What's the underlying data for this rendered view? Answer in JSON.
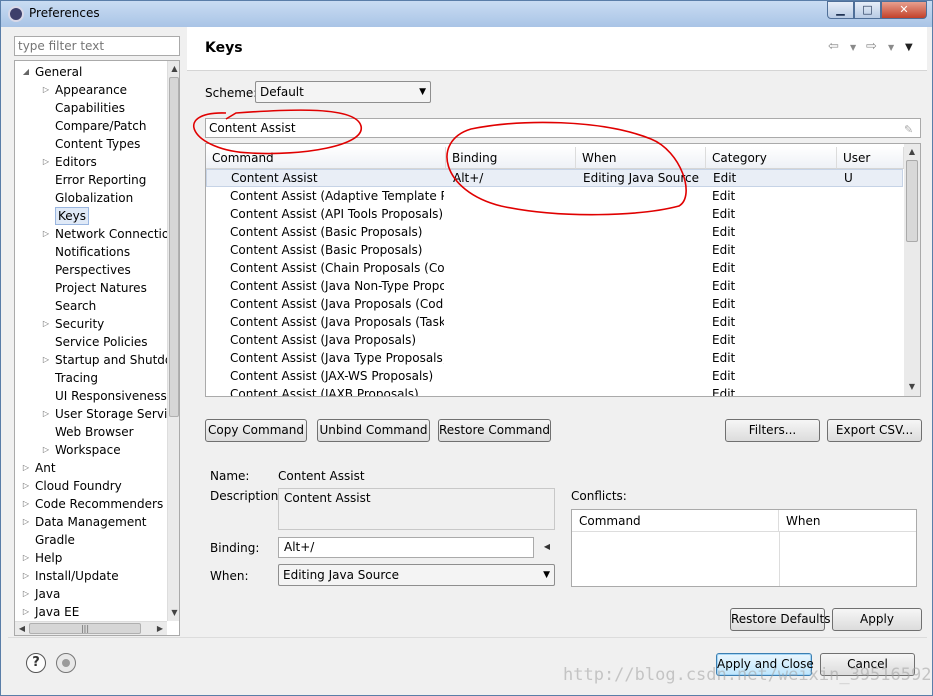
{
  "window": {
    "title": "Preferences",
    "min": "▁",
    "max": "□",
    "close": "✕"
  },
  "filter": {
    "placeholder": "type filter text"
  },
  "tree": [
    {
      "label": "General",
      "level": 0,
      "twisty": "expanded"
    },
    {
      "label": "Appearance",
      "level": 1,
      "twisty": "collapsed"
    },
    {
      "label": "Capabilities",
      "level": 1,
      "twisty": "none"
    },
    {
      "label": "Compare/Patch",
      "level": 1,
      "twisty": "none"
    },
    {
      "label": "Content Types",
      "level": 1,
      "twisty": "none"
    },
    {
      "label": "Editors",
      "level": 1,
      "twisty": "collapsed"
    },
    {
      "label": "Error Reporting",
      "level": 1,
      "twisty": "none"
    },
    {
      "label": "Globalization",
      "level": 1,
      "twisty": "none"
    },
    {
      "label": "Keys",
      "level": 1,
      "twisty": "none",
      "selected": true
    },
    {
      "label": "Network Connection",
      "level": 1,
      "twisty": "collapsed"
    },
    {
      "label": "Notifications",
      "level": 1,
      "twisty": "none"
    },
    {
      "label": "Perspectives",
      "level": 1,
      "twisty": "none"
    },
    {
      "label": "Project Natures",
      "level": 1,
      "twisty": "none"
    },
    {
      "label": "Search",
      "level": 1,
      "twisty": "none"
    },
    {
      "label": "Security",
      "level": 1,
      "twisty": "collapsed"
    },
    {
      "label": "Service Policies",
      "level": 1,
      "twisty": "none"
    },
    {
      "label": "Startup and Shutdov",
      "level": 1,
      "twisty": "collapsed"
    },
    {
      "label": "Tracing",
      "level": 1,
      "twisty": "none"
    },
    {
      "label": "UI Responsiveness M",
      "level": 1,
      "twisty": "none"
    },
    {
      "label": "User Storage Service",
      "level": 1,
      "twisty": "collapsed"
    },
    {
      "label": "Web Browser",
      "level": 1,
      "twisty": "none"
    },
    {
      "label": "Workspace",
      "level": 1,
      "twisty": "collapsed"
    },
    {
      "label": "Ant",
      "level": 0,
      "twisty": "collapsed"
    },
    {
      "label": "Cloud Foundry",
      "level": 0,
      "twisty": "collapsed"
    },
    {
      "label": "Code Recommenders",
      "level": 0,
      "twisty": "collapsed"
    },
    {
      "label": "Data Management",
      "level": 0,
      "twisty": "collapsed"
    },
    {
      "label": "Gradle",
      "level": 0,
      "twisty": "none"
    },
    {
      "label": "Help",
      "level": 0,
      "twisty": "collapsed"
    },
    {
      "label": "Install/Update",
      "level": 0,
      "twisty": "collapsed"
    },
    {
      "label": "Java",
      "level": 0,
      "twisty": "collapsed"
    },
    {
      "label": "Java EE",
      "level": 0,
      "twisty": "collapsed"
    }
  ],
  "page": {
    "title": "Keys",
    "scheme_label": "Scheme:",
    "scheme_value": "Default",
    "search_value": "Content Assist",
    "columns": [
      "Command",
      "Binding",
      "When",
      "Category",
      "User"
    ],
    "rows": [
      {
        "command": "Content Assist",
        "binding": "Alt+/",
        "when": "Editing Java Source",
        "category": "Edit",
        "user": "U",
        "selected": true
      },
      {
        "command": "Content Assist (Adaptive Template Propo",
        "binding": "",
        "when": "",
        "category": "Edit",
        "user": ""
      },
      {
        "command": "Content Assist (API Tools Proposals)",
        "binding": "",
        "when": "",
        "category": "Edit",
        "user": ""
      },
      {
        "command": "Content Assist (Basic Proposals)",
        "binding": "",
        "when": "",
        "category": "Edit",
        "user": ""
      },
      {
        "command": "Content Assist (Basic Proposals)",
        "binding": "",
        "when": "",
        "category": "Edit",
        "user": ""
      },
      {
        "command": "Content Assist (Chain Proposals (Code Re",
        "binding": "",
        "when": "",
        "category": "Edit",
        "user": ""
      },
      {
        "command": "Content Assist (Java Non-Type Proposals",
        "binding": "",
        "when": "",
        "category": "Edit",
        "user": ""
      },
      {
        "command": "Content Assist (Java Proposals (Code Rec",
        "binding": "",
        "when": "",
        "category": "Edit",
        "user": ""
      },
      {
        "command": "Content Assist (Java Proposals (Task-Focu",
        "binding": "",
        "when": "",
        "category": "Edit",
        "user": ""
      },
      {
        "command": "Content Assist (Java Proposals)",
        "binding": "",
        "when": "",
        "category": "Edit",
        "user": ""
      },
      {
        "command": "Content Assist (Java Type Proposals)",
        "binding": "",
        "when": "",
        "category": "Edit",
        "user": ""
      },
      {
        "command": "Content Assist (JAX-WS Proposals)",
        "binding": "",
        "when": "",
        "category": "Edit",
        "user": ""
      },
      {
        "command": "Content Assist (JAXB Proposals)",
        "binding": "",
        "when": "",
        "category": "Edit",
        "user": ""
      }
    ],
    "buttons": {
      "copy": "Copy Command",
      "unbind": "Unbind Command",
      "restore_cmd": "Restore Command",
      "filters": "Filters...",
      "export": "Export CSV..."
    },
    "details": {
      "name_label": "Name:",
      "name_value": "Content Assist",
      "description_label": "Description:",
      "description_value": "Content Assist",
      "binding_label": "Binding:",
      "binding_value": "Alt+/",
      "when_label": "When:",
      "when_value": "Editing Java Source"
    },
    "conflicts": {
      "label": "Conflicts:",
      "columns": [
        "Command",
        "When"
      ]
    },
    "restore_defaults": "Restore Defaults",
    "apply": "Apply"
  },
  "footer": {
    "apply_close": "Apply and Close",
    "cancel": "Cancel"
  },
  "watermark": "http://blog.csdn.net/weixin_39516592",
  "colors": {
    "annotation": "#e00000",
    "selection": "#dfe9f7",
    "titlebar": "#a9c4e6"
  }
}
